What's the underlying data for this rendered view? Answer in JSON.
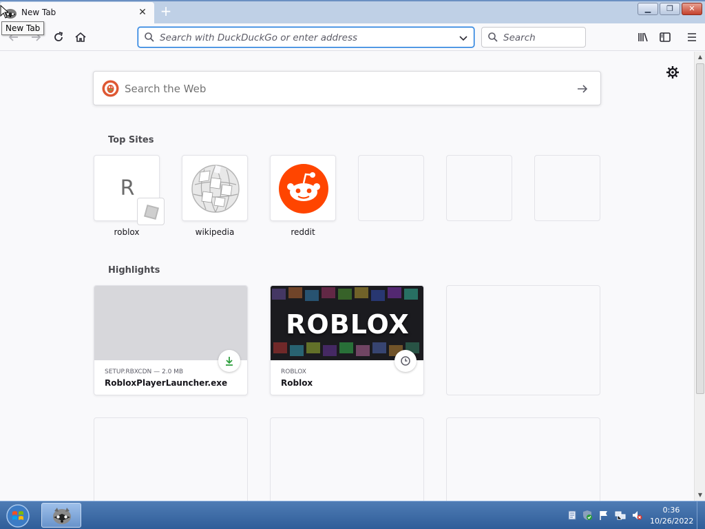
{
  "browser": {
    "tab_title": "New Tab",
    "tooltip": "New Tab",
    "url_placeholder": "Search with DuckDuckGo or enter address",
    "search_placeholder": "Search"
  },
  "newtab": {
    "web_search_placeholder": "Search the Web",
    "top_sites_title": "Top Sites",
    "highlights_title": "Highlights",
    "top_sites": [
      {
        "label": "roblox",
        "letter": "R"
      },
      {
        "label": "wikipedia"
      },
      {
        "label": "reddit"
      }
    ],
    "highlights": [
      {
        "meta": "SETUP.RBXCDN — 2.0 MB",
        "title": "RobloxPlayerLauncher.exe",
        "badge": "download-icon"
      },
      {
        "meta": "ROBLOX",
        "title": "Roblox",
        "badge": "clock-icon",
        "thumb_text": "ROBLOX"
      }
    ]
  },
  "taskbar": {
    "time": "0:36",
    "date": "10/26/2022"
  },
  "colors": {
    "accent": "#0b6fd8",
    "reddit": "#ff4500",
    "download": "#2a9d3a"
  }
}
